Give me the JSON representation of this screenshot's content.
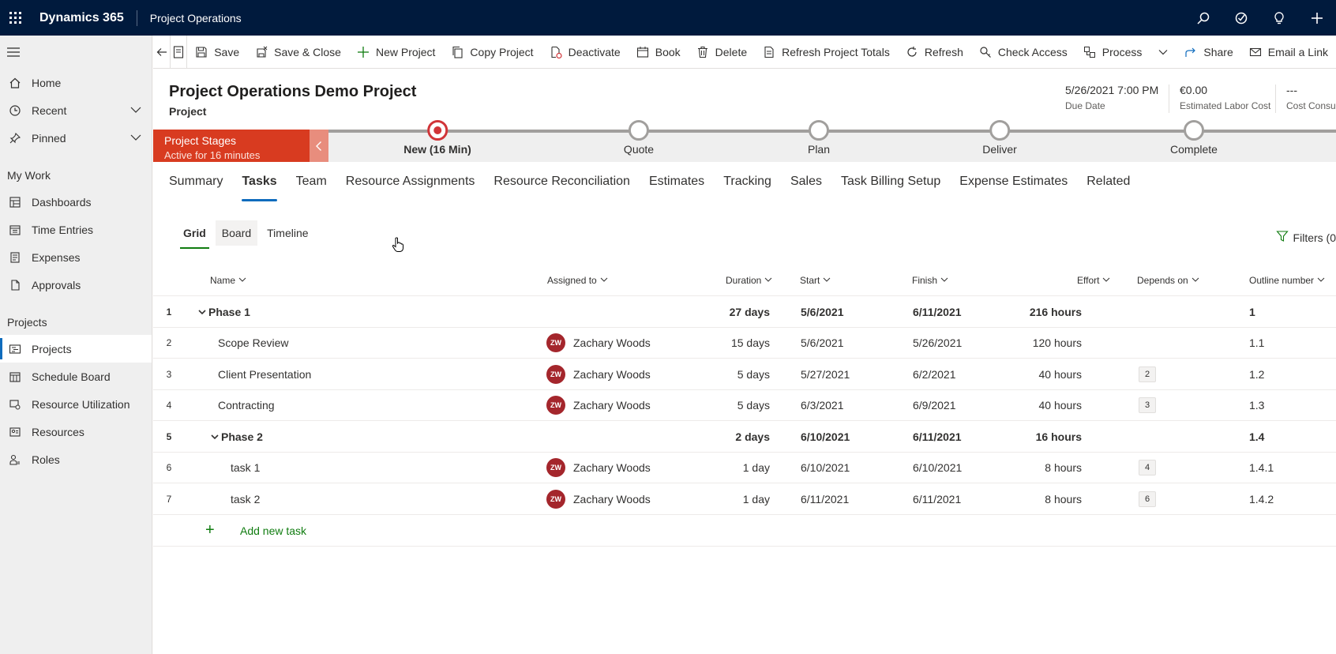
{
  "topbar": {
    "brand": "Dynamics 365",
    "app_name": "Project Operations",
    "icons": [
      "search-icon",
      "task-flow-icon",
      "lightbulb-icon",
      "add-icon"
    ]
  },
  "sidebar": {
    "items": [
      {
        "label": "Home",
        "icon": "home-icon"
      },
      {
        "label": "Recent",
        "icon": "clock-icon"
      },
      {
        "label": "Pinned",
        "icon": "pin-icon"
      }
    ],
    "sections": [
      {
        "title": "My Work",
        "items": [
          {
            "label": "Dashboards",
            "icon": "dashboard-icon"
          },
          {
            "label": "Time Entries",
            "icon": "calendar-icon"
          },
          {
            "label": "Expenses",
            "icon": "receipt-icon"
          },
          {
            "label": "Approvals",
            "icon": "document-icon"
          }
        ]
      },
      {
        "title": "Projects",
        "items": [
          {
            "label": "Projects",
            "icon": "project-icon"
          },
          {
            "label": "Schedule Board",
            "icon": "calendar-icon"
          },
          {
            "label": "Resource Utilization",
            "icon": "chart-icon"
          },
          {
            "label": "Resources",
            "icon": "people-icon"
          },
          {
            "label": "Roles",
            "icon": "person-icon"
          }
        ]
      }
    ]
  },
  "commands": [
    {
      "label": "Save",
      "icon": "save-icon"
    },
    {
      "label": "Save & Close",
      "icon": "save-close-icon"
    },
    {
      "label": "New Project",
      "icon": "plus-icon"
    },
    {
      "label": "Copy Project",
      "icon": "copy-icon"
    },
    {
      "label": "Deactivate",
      "icon": "deactivate-icon"
    },
    {
      "label": "Book",
      "icon": "book-icon"
    },
    {
      "label": "Delete",
      "icon": "delete-icon"
    },
    {
      "label": "Refresh Project Totals",
      "icon": "document-icon"
    },
    {
      "label": "Refresh",
      "icon": "refresh-icon"
    },
    {
      "label": "Check Access",
      "icon": "key-icon"
    },
    {
      "label": "Process",
      "icon": "process-icon"
    },
    {
      "label": "Share",
      "icon": "share-icon"
    },
    {
      "label": "Email a Link",
      "icon": "email-icon"
    }
  ],
  "record": {
    "title": "Project Operations Demo Project",
    "type": "Project",
    "fields": [
      {
        "value": "5/26/2021 7:00 PM",
        "label": "Due Date"
      },
      {
        "value": "€0.00",
        "label": "Estimated Labor Cost"
      },
      {
        "value": "---",
        "label": "Cost Consu"
      }
    ]
  },
  "bpf": {
    "title": "Project Stages",
    "subtitle": "Active for 16 minutes",
    "stages": [
      "New  (16 Min)",
      "Quote",
      "Plan",
      "Deliver",
      "Complete"
    ],
    "current_stage": 0
  },
  "tabs": [
    "Summary",
    "Tasks",
    "Team",
    "Resource Assignments",
    "Resource Reconciliation",
    "Estimates",
    "Tracking",
    "Sales",
    "Task Billing Setup",
    "Expense Estimates",
    "Related"
  ],
  "active_tab": 1,
  "subtabs": [
    "Grid",
    "Board",
    "Timeline"
  ],
  "filters_label": "Filters (0",
  "grid": {
    "columns": [
      "Name",
      "Assigned to",
      "Duration",
      "Start",
      "Finish",
      "Effort",
      "Depends on",
      "Outline number"
    ],
    "rows": [
      {
        "num": "1",
        "name": "Phase 1",
        "assigned": "",
        "initials": "",
        "duration": "27 days",
        "start": "5/6/2021",
        "finish": "6/11/2021",
        "effort": "216 hours",
        "depends": "",
        "outline": "1",
        "summary": true,
        "level": 0
      },
      {
        "num": "2",
        "name": "Scope Review",
        "assigned": "Zachary Woods",
        "initials": "ZW",
        "duration": "15 days",
        "start": "5/6/2021",
        "finish": "5/26/2021",
        "effort": "120 hours",
        "depends": "",
        "outline": "1.1",
        "summary": false,
        "level": 1
      },
      {
        "num": "3",
        "name": "Client Presentation",
        "assigned": "Zachary Woods",
        "initials": "ZW",
        "duration": "5 days",
        "start": "5/27/2021",
        "finish": "6/2/2021",
        "effort": "40 hours",
        "depends": "2",
        "outline": "1.2",
        "summary": false,
        "level": 1
      },
      {
        "num": "4",
        "name": "Contracting",
        "assigned": "Zachary Woods",
        "initials": "ZW",
        "duration": "5 days",
        "start": "6/3/2021",
        "finish": "6/9/2021",
        "effort": "40 hours",
        "depends": "3",
        "outline": "1.3",
        "summary": false,
        "level": 1
      },
      {
        "num": "5",
        "name": "Phase 2",
        "assigned": "",
        "initials": "",
        "duration": "2 days",
        "start": "6/10/2021",
        "finish": "6/11/2021",
        "effort": "16 hours",
        "depends": "",
        "outline": "1.4",
        "summary": true,
        "level": 1
      },
      {
        "num": "6",
        "name": "task 1",
        "assigned": "Zachary Woods",
        "initials": "ZW",
        "duration": "1 day",
        "start": "6/10/2021",
        "finish": "6/10/2021",
        "effort": "8 hours",
        "depends": "4",
        "outline": "1.4.1",
        "summary": false,
        "level": 2
      },
      {
        "num": "7",
        "name": "task 2",
        "assigned": "Zachary Woods",
        "initials": "ZW",
        "duration": "1 day",
        "start": "6/11/2021",
        "finish": "6/11/2021",
        "effort": "8 hours",
        "depends": "6",
        "outline": "1.4.2",
        "summary": false,
        "level": 2
      }
    ],
    "add_label": "Add new task"
  }
}
